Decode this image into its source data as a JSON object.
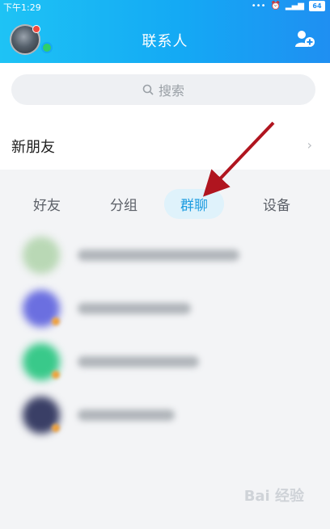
{
  "status": {
    "time": "下午1:29",
    "battery": "64"
  },
  "header": {
    "title": "联系人"
  },
  "search": {
    "placeholder": "搜索"
  },
  "new_friend": {
    "label": "新朋友"
  },
  "tabs": [
    {
      "label": "好友",
      "active": false
    },
    {
      "label": "分组",
      "active": false
    },
    {
      "label": "群聊",
      "active": true
    },
    {
      "label": "设备",
      "active": false
    }
  ],
  "groups": [
    {
      "avatar_color": "#b9d8b5"
    },
    {
      "avatar_color": "#6b6fe0"
    },
    {
      "avatar_color": "#39c98a"
    },
    {
      "avatar_color": "#3a3f66"
    }
  ],
  "watermark": "Bai 经验",
  "colors": {
    "accent": "#1e9ce0",
    "header_start": "#1ec3f5",
    "header_end": "#1f8ff2",
    "arrow": "#b0151f"
  }
}
